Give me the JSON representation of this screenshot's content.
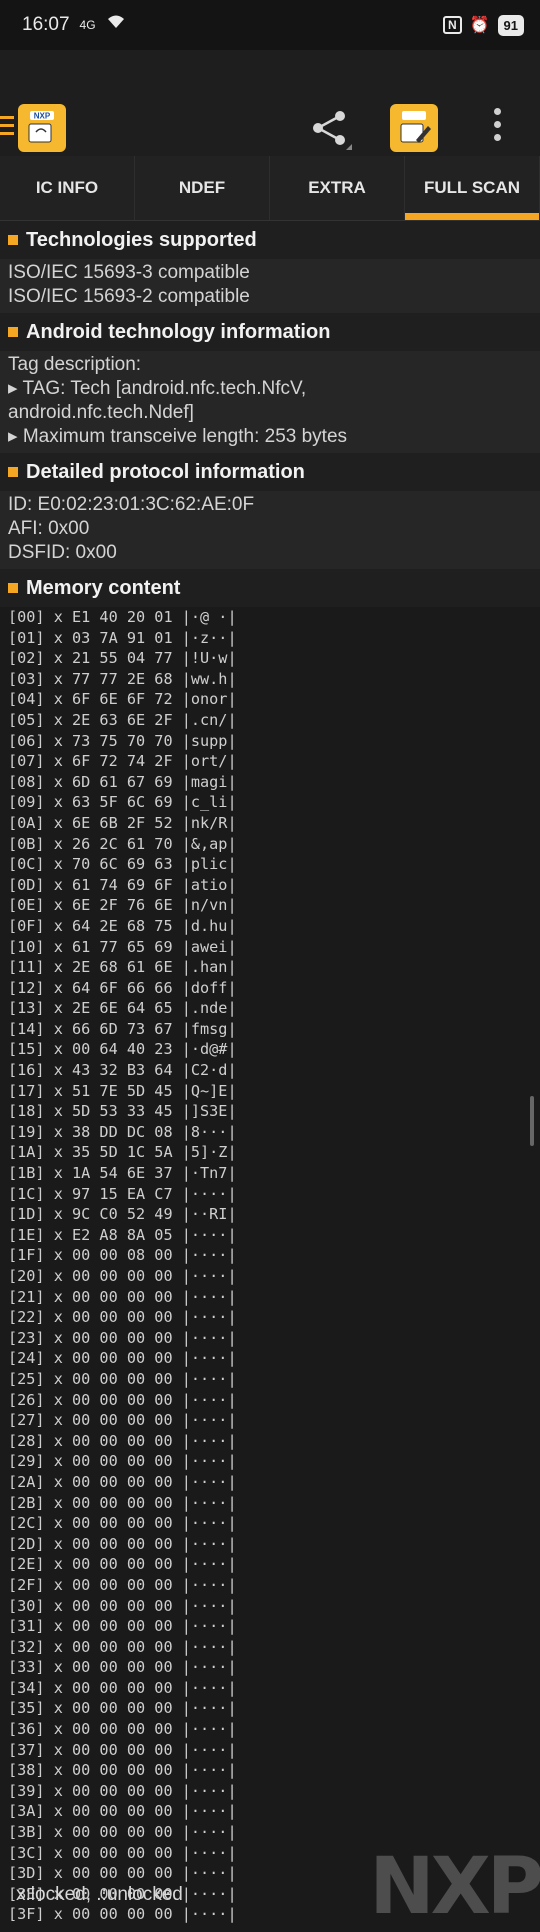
{
  "status": {
    "time": "16:07",
    "signal": "4G",
    "battery": "91"
  },
  "toolbar": {
    "logo_text": "NXP"
  },
  "tabs": [
    {
      "label": "IC INFO"
    },
    {
      "label": "NDEF"
    },
    {
      "label": "EXTRA"
    },
    {
      "label": "FULL SCAN"
    }
  ],
  "sections": {
    "technologies": {
      "title": "Technologies supported",
      "lines": [
        "ISO/IEC 15693-3 compatible",
        "ISO/IEC 15693-2 compatible"
      ]
    },
    "android": {
      "title": "Android technology information",
      "lines": [
        "Tag description:",
        "▸ TAG: Tech [android.nfc.tech.NfcV,",
        "android.nfc.tech.Ndef]",
        "▸ Maximum transceive length: 253 bytes"
      ]
    },
    "protocol": {
      "title": "Detailed protocol information",
      "lines": [
        "ID: E0:02:23:01:3C:62:AE:0F",
        "AFI: 0x00",
        "DSFID: 0x00"
      ]
    },
    "memory": {
      "title": "Memory content",
      "rows": [
        "[00] x E1 40 20 01 |·@ ·|",
        "[01] x 03 7A 91 01 |·z··|",
        "[02] x 21 55 04 77 |!U·w|",
        "[03] x 77 77 2E 68 |ww.h|",
        "[04] x 6F 6E 6F 72 |onor|",
        "[05] x 2E 63 6E 2F |.cn/|",
        "[06] x 73 75 70 70 |supp|",
        "[07] x 6F 72 74 2F |ort/|",
        "[08] x 6D 61 67 69 |magi|",
        "[09] x 63 5F 6C 69 |c_li|",
        "[0A] x 6E 6B 2F 52 |nk/R|",
        "[0B] x 26 2C 61 70 |&,ap|",
        "[0C] x 70 6C 69 63 |plic|",
        "[0D] x 61 74 69 6F |atio|",
        "[0E] x 6E 2F 76 6E |n/vn|",
        "[0F] x 64 2E 68 75 |d.hu|",
        "[10] x 61 77 65 69 |awei|",
        "[11] x 2E 68 61 6E |.han|",
        "[12] x 64 6F 66 66 |doff|",
        "[13] x 2E 6E 64 65 |.nde|",
        "[14] x 66 6D 73 67 |fmsg|",
        "[15] x 00 64 40 23 |·d@#|",
        "[16] x 43 32 B3 64 |C2·d|",
        "[17] x 51 7E 5D 45 |Q~]E|",
        "[18] x 5D 53 33 45 |]S3E|",
        "[19] x 38 DD DC 08 |8···|",
        "[1A] x 35 5D 1C 5A |5]·Z|",
        "[1B] x 1A 54 6E 37 |·Tn7|",
        "[1C] x 97 15 EA C7 |····|",
        "[1D] x 9C C0 52 49 |··RI|",
        "[1E] x E2 A8 8A 05 |····|",
        "[1F] x 00 00 08 00 |····|",
        "[20] x 00 00 00 00 |····|",
        "[21] x 00 00 00 00 |····|",
        "[22] x 00 00 00 00 |····|",
        "[23] x 00 00 00 00 |····|",
        "[24] x 00 00 00 00 |····|",
        "[25] x 00 00 00 00 |····|",
        "[26] x 00 00 00 00 |····|",
        "[27] x 00 00 00 00 |····|",
        "[28] x 00 00 00 00 |····|",
        "[29] x 00 00 00 00 |····|",
        "[2A] x 00 00 00 00 |····|",
        "[2B] x 00 00 00 00 |····|",
        "[2C] x 00 00 00 00 |····|",
        "[2D] x 00 00 00 00 |····|",
        "[2E] x 00 00 00 00 |····|",
        "[2F] x 00 00 00 00 |····|",
        "[30] x 00 00 00 00 |····|",
        "[31] x 00 00 00 00 |····|",
        "[32] x 00 00 00 00 |····|",
        "[33] x 00 00 00 00 |····|",
        "[34] x 00 00 00 00 |····|",
        "[35] x 00 00 00 00 |····|",
        "[36] x 00 00 00 00 |····|",
        "[37] x 00 00 00 00 |····|",
        "[38] x 00 00 00 00 |····|",
        "[39] x 00 00 00 00 |····|",
        "[3A] x 00 00 00 00 |····|",
        "[3B] x 00 00 00 00 |····|",
        "[3C] x 00 00 00 00 |····|",
        "[3D] x 00 00 00 00 |····|",
        "[3E] x 00 00 00 00 |····|",
        "[3F] x 00 00 00 00 |····|"
      ]
    }
  },
  "legend": "x:locked, .:unlocked",
  "watermark": "NXP",
  "colors": {
    "accent": "#f5a623",
    "background": "#1a1a1a"
  }
}
